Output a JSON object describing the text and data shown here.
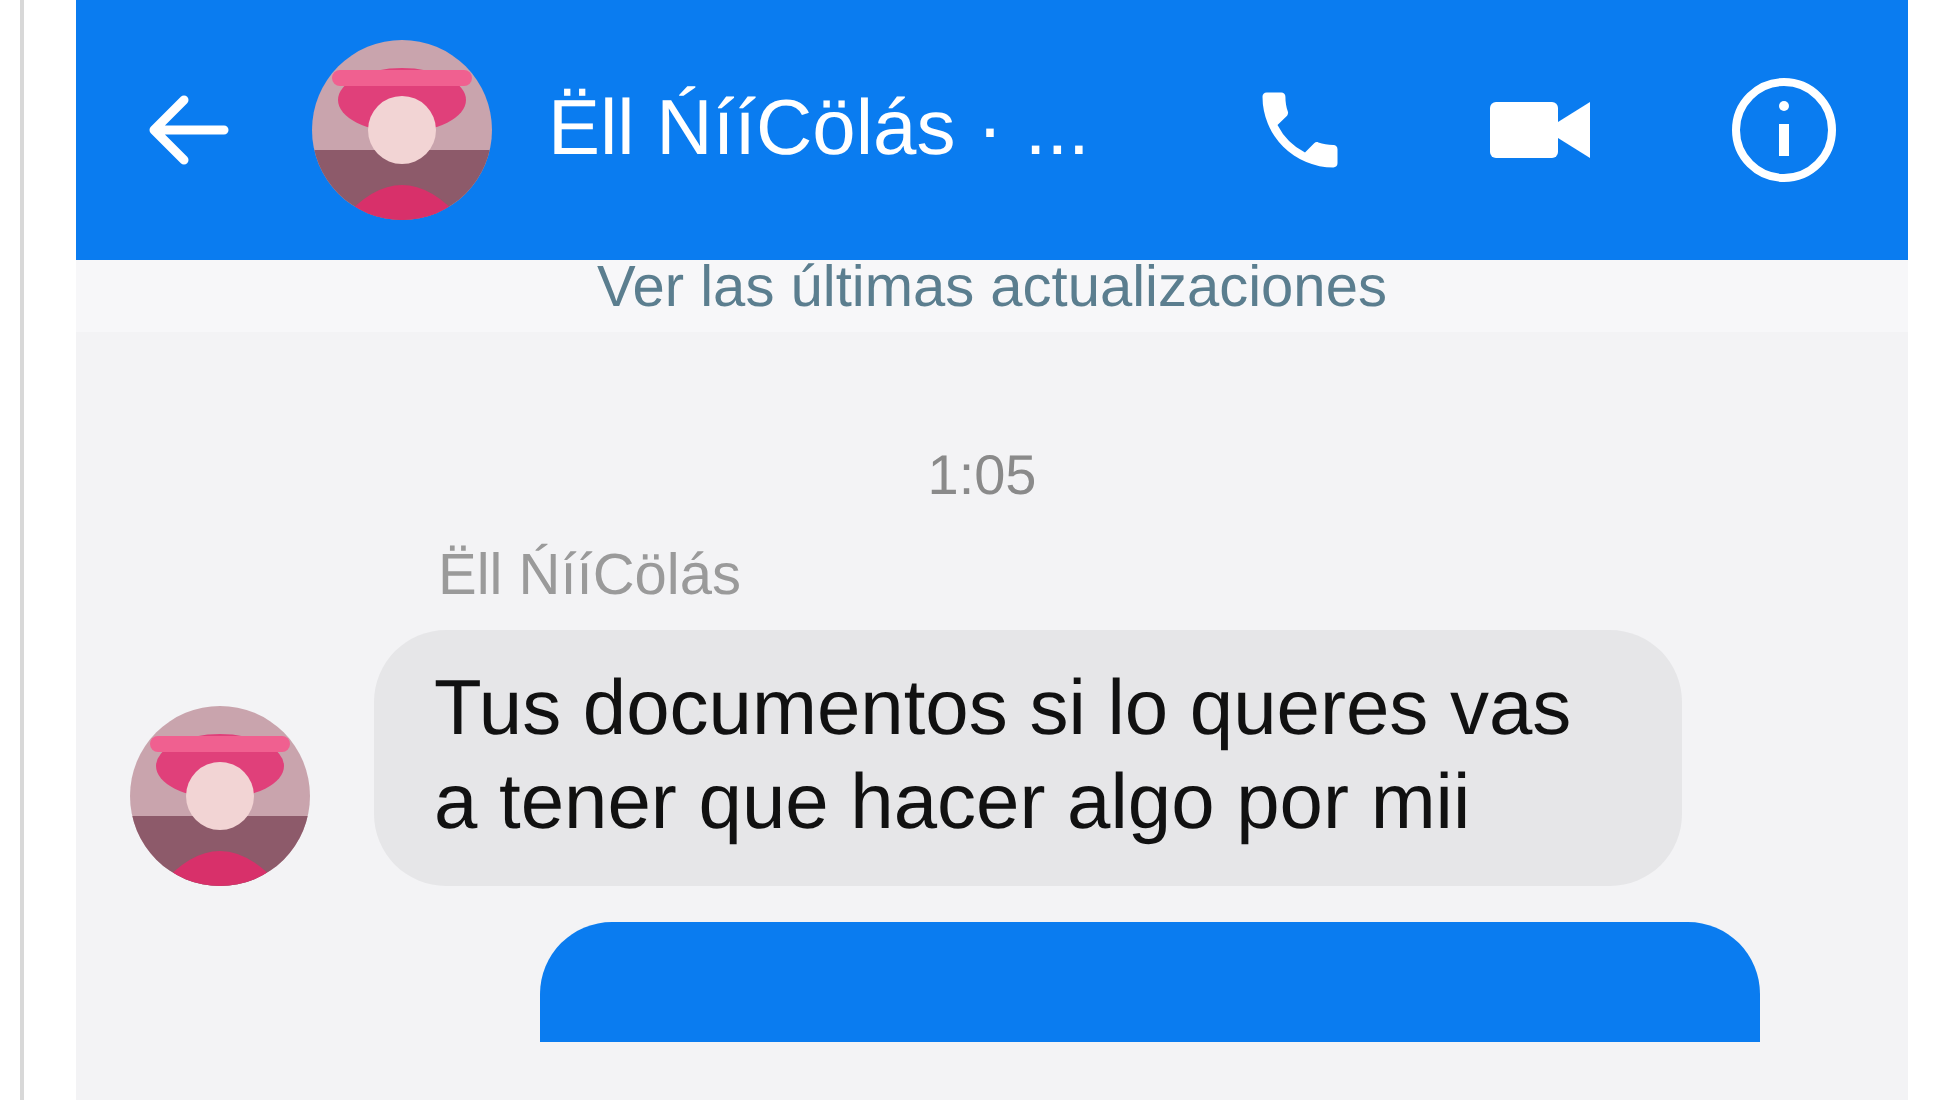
{
  "header": {
    "contact_name": "Ëll ŃííCölás · ..."
  },
  "banner": "Ver las últimas actualizaciones",
  "messages": [
    {
      "kind": "time",
      "text": "1:05"
    },
    {
      "kind": "sender",
      "text": "Ëll ŃííCölás"
    },
    {
      "kind": "incoming",
      "text": "Tus documentos si lo queres vas a tener que hacer algo por mii"
    },
    {
      "kind": "outgoing"
    }
  ]
}
